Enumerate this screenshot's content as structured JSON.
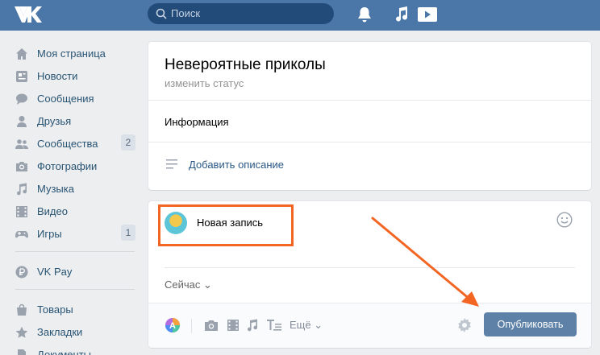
{
  "header": {
    "logo": "VK",
    "search_placeholder": "Поиск",
    "brand_color": "#4a76a8",
    "icons": [
      "bell-icon",
      "music-note-icon",
      "play-icon"
    ]
  },
  "sidebar": {
    "items": [
      {
        "label": "Моя страница",
        "icon": "home-icon"
      },
      {
        "label": "Новости",
        "icon": "news-icon"
      },
      {
        "label": "Сообщения",
        "icon": "chat-icon"
      },
      {
        "label": "Друзья",
        "icon": "person-icon"
      },
      {
        "label": "Сообщества",
        "icon": "people-icon",
        "badge": "2"
      },
      {
        "label": "Фотографии",
        "icon": "camera-icon"
      },
      {
        "label": "Музыка",
        "icon": "music-icon"
      },
      {
        "label": "Видео",
        "icon": "film-icon"
      },
      {
        "label": "Игры",
        "icon": "gamepad-icon",
        "badge": "1"
      },
      {
        "label": "VK Pay",
        "icon": "ruble-icon"
      },
      {
        "label": "Товары",
        "icon": "bag-icon"
      },
      {
        "label": "Закладки",
        "icon": "star-icon"
      },
      {
        "label": "Документы",
        "icon": "document-icon"
      }
    ]
  },
  "profile": {
    "title": "Невероятные приколы",
    "status_placeholder": "изменить статус",
    "info_label": "Информация",
    "add_description": "Добавить описание"
  },
  "composer": {
    "new_post": "Новая запись",
    "time": "Сейчас",
    "more": "Ещё",
    "publish": "Опубликовать",
    "highlight_color": "#f26522"
  }
}
